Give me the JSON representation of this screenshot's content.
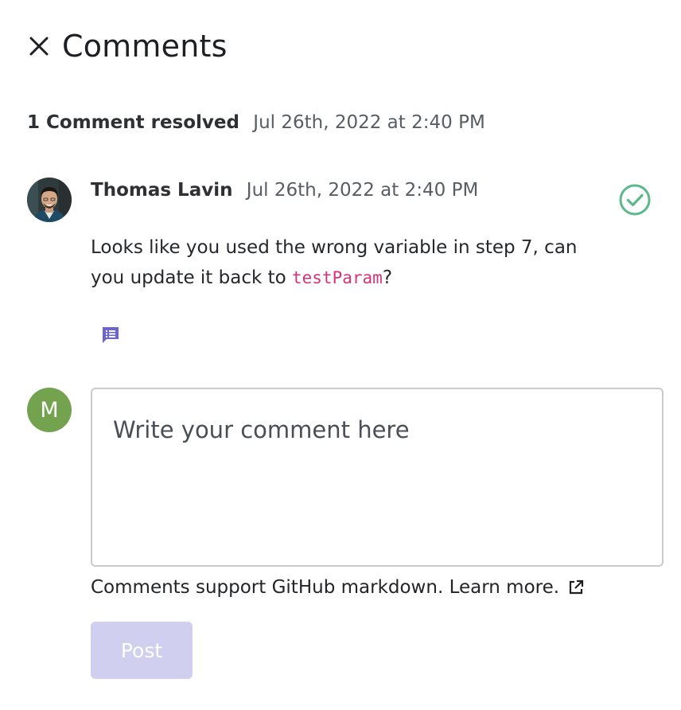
{
  "header": {
    "title": "Comments",
    "close_icon": "close-icon"
  },
  "thread": {
    "resolved_label": "1 Comment resolved",
    "resolved_time": "Jul 26th, 2022 at 2:40 PM"
  },
  "comment": {
    "author": "Thomas Lavin",
    "time": "Jul 26th, 2022 at 2:40 PM",
    "body_before": "Looks like you used the wrong variable in step 7, can you update it back to ",
    "body_code": "testParam",
    "body_after": "?",
    "resolved_icon": "check-circle-icon",
    "thread_icon": "comment-thread-icon",
    "status_color": "#5bb98c"
  },
  "composer": {
    "avatar_initial": "M",
    "avatar_color": "#74a34f",
    "placeholder": "Write your comment here",
    "value": "",
    "markdown_note": "Comments support GitHub markdown. Learn more.",
    "external_link_icon": "external-link-icon",
    "post_label": "Post",
    "post_color": "#d0cff0"
  },
  "colors": {
    "accent": "#6b64d6",
    "code": "#d6337a"
  }
}
